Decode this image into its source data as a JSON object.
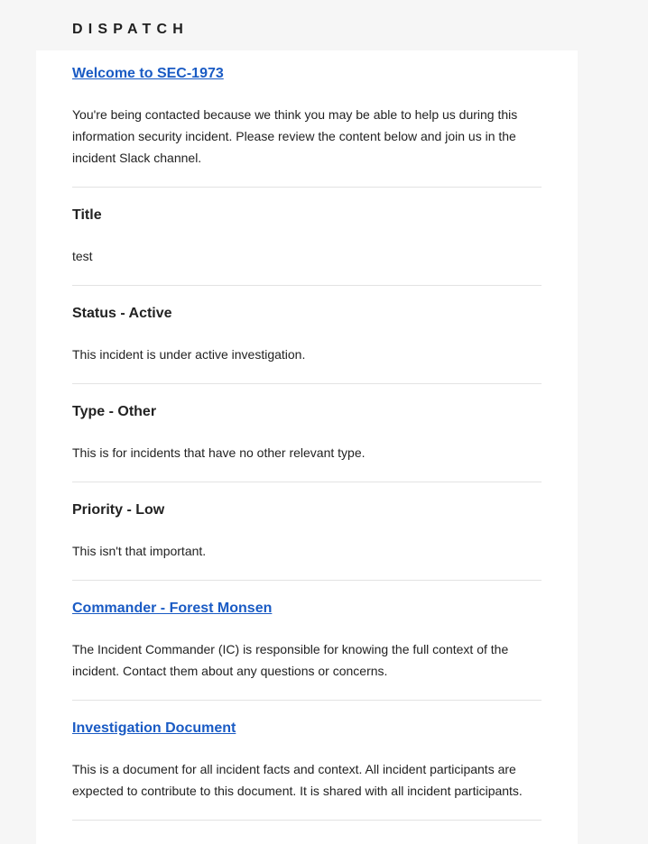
{
  "brand": "DISPATCH",
  "welcome": {
    "heading": "Welcome to SEC-1973",
    "body": "You're being contacted because we think you may be able to help us during this information security incident. Please review the content below and join us in the incident Slack channel."
  },
  "title": {
    "heading": "Title",
    "body": "test"
  },
  "status": {
    "heading": "Status - Active",
    "body": "This incident is under active investigation."
  },
  "type": {
    "heading": "Type - Other",
    "body": "This is for incidents that have no other relevant type."
  },
  "priority": {
    "heading": "Priority - Low",
    "body": "This isn't that important."
  },
  "commander": {
    "heading": "Commander - Forest Monsen",
    "body": "The Incident Commander (IC) is responsible for knowing the full context of the incident. Contact them about any questions or concerns."
  },
  "investigation": {
    "heading": "Investigation Document",
    "body": "This is a document for all incident facts and context. All incident participants are expected to contribute to this document. It is shared with all incident participants."
  },
  "colors": {
    "link": "#1a5bc4",
    "background": "#f6f6f6",
    "card": "#ffffff",
    "divider": "#e3e3e3"
  }
}
